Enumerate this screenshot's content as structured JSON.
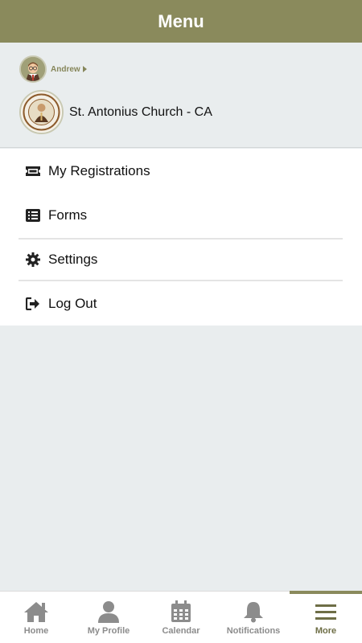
{
  "header": {
    "title": "Menu"
  },
  "profile": {
    "user_name": "Andrew",
    "church_name": "St. Antonius Church - CA"
  },
  "menu": {
    "items": [
      {
        "label": "My Registrations",
        "icon": "ticket-icon"
      },
      {
        "label": "Forms",
        "icon": "list-icon"
      },
      {
        "label": "Settings",
        "icon": "gear-icon"
      },
      {
        "label": "Log Out",
        "icon": "logout-icon"
      }
    ]
  },
  "tabbar": {
    "active": "More",
    "tabs": [
      {
        "label": "Home",
        "icon": "home-icon"
      },
      {
        "label": "My Profile",
        "icon": "person-icon"
      },
      {
        "label": "Calendar",
        "icon": "calendar-icon"
      },
      {
        "label": "Notifications",
        "icon": "bell-icon"
      },
      {
        "label": "More",
        "icon": "hamburger-icon"
      }
    ]
  },
  "colors": {
    "accent": "#8a8a5c",
    "background": "#e9edee",
    "tab_inactive": "#8c8c8c"
  }
}
